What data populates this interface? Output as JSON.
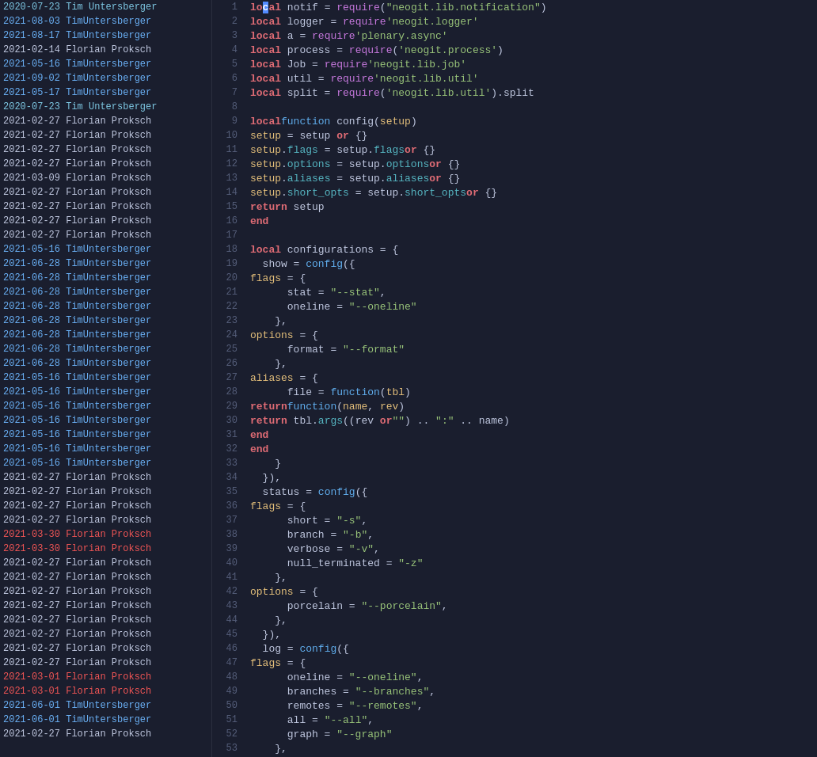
{
  "blame": [
    {
      "date": "2020-07-23",
      "author": "Tim Untersberger",
      "type": "tun-old"
    },
    {
      "date": "2021-08-03",
      "author": "TimUntersberger",
      "type": "tun"
    },
    {
      "date": "2021-08-17",
      "author": "TimUntersberger",
      "type": "tun"
    },
    {
      "date": "2021-02-14",
      "author": "Florian Proksch",
      "type": "fp"
    },
    {
      "date": "2021-05-16",
      "author": "TimUntersberger",
      "type": "tun"
    },
    {
      "date": "2021-09-02",
      "author": "TimUntersberger",
      "type": "tun"
    },
    {
      "date": "2021-05-17",
      "author": "TimUntersberger",
      "type": "tun"
    },
    {
      "date": "2020-07-23",
      "author": "Tim Untersberger",
      "type": "tun-old"
    },
    {
      "date": "2021-02-27",
      "author": "Florian Proksch",
      "type": "fp"
    },
    {
      "date": "2021-02-27",
      "author": "Florian Proksch",
      "type": "fp"
    },
    {
      "date": "2021-02-27",
      "author": "Florian Proksch",
      "type": "fp"
    },
    {
      "date": "2021-02-27",
      "author": "Florian Proksch",
      "type": "fp"
    },
    {
      "date": "2021-03-09",
      "author": "Florian Proksch",
      "type": "fp"
    },
    {
      "date": "2021-02-27",
      "author": "Florian Proksch",
      "type": "fp"
    },
    {
      "date": "2021-02-27",
      "author": "Florian Proksch",
      "type": "fp"
    },
    {
      "date": "2021-02-27",
      "author": "Florian Proksch",
      "type": "fp"
    },
    {
      "date": "2021-02-27",
      "author": "Florian Proksch",
      "type": "fp"
    },
    {
      "date": "2021-05-16",
      "author": "TimUntersberger",
      "type": "tun"
    },
    {
      "date": "2021-06-28",
      "author": "TimUntersberger",
      "type": "tun"
    },
    {
      "date": "2021-06-28",
      "author": "TimUntersberger",
      "type": "tun"
    },
    {
      "date": "2021-06-28",
      "author": "TimUntersberger",
      "type": "tun"
    },
    {
      "date": "2021-06-28",
      "author": "TimUntersberger",
      "type": "tun"
    },
    {
      "date": "2021-06-28",
      "author": "TimUntersberger",
      "type": "tun"
    },
    {
      "date": "2021-06-28",
      "author": "TimUntersberger",
      "type": "tun"
    },
    {
      "date": "2021-06-28",
      "author": "TimUntersberger",
      "type": "tun"
    },
    {
      "date": "2021-06-28",
      "author": "TimUntersberger",
      "type": "tun"
    },
    {
      "date": "2021-05-16",
      "author": "TimUntersberger",
      "type": "tun"
    },
    {
      "date": "2021-05-16",
      "author": "TimUntersberger",
      "type": "tun"
    },
    {
      "date": "2021-05-16",
      "author": "TimUntersberger",
      "type": "tun"
    },
    {
      "date": "2021-05-16",
      "author": "TimUntersberger",
      "type": "tun"
    },
    {
      "date": "2021-05-16",
      "author": "TimUntersberger",
      "type": "tun"
    },
    {
      "date": "2021-05-16",
      "author": "TimUntersberger",
      "type": "tun"
    },
    {
      "date": "2021-05-16",
      "author": "TimUntersberger",
      "type": "tun"
    },
    {
      "date": "2021-02-27",
      "author": "Florian Proksch",
      "type": "fp"
    },
    {
      "date": "2021-02-27",
      "author": "Florian Proksch",
      "type": "fp"
    },
    {
      "date": "2021-02-27",
      "author": "Florian Proksch",
      "type": "fp"
    },
    {
      "date": "2021-02-27",
      "author": "Florian Proksch",
      "type": "fp"
    },
    {
      "date": "2021-03-30",
      "author": "Florian Proksch",
      "type": "fp-red"
    },
    {
      "date": "2021-03-30",
      "author": "Florian Proksch",
      "type": "fp-red"
    },
    {
      "date": "2021-02-27",
      "author": "Florian Proksch",
      "type": "fp"
    },
    {
      "date": "2021-02-27",
      "author": "Florian Proksch",
      "type": "fp"
    },
    {
      "date": "2021-02-27",
      "author": "Florian Proksch",
      "type": "fp"
    },
    {
      "date": "2021-02-27",
      "author": "Florian Proksch",
      "type": "fp"
    },
    {
      "date": "2021-02-27",
      "author": "Florian Proksch",
      "type": "fp"
    },
    {
      "date": "2021-02-27",
      "author": "Florian Proksch",
      "type": "fp"
    },
    {
      "date": "2021-02-27",
      "author": "Florian Proksch",
      "type": "fp"
    },
    {
      "date": "2021-02-27",
      "author": "Florian Proksch",
      "type": "fp"
    },
    {
      "date": "2021-03-01",
      "author": "Florian Proksch",
      "type": "fp-red"
    },
    {
      "date": "2021-03-01",
      "author": "Florian Proksch",
      "type": "fp-red"
    },
    {
      "date": "2021-06-01",
      "author": "TimUntersberger",
      "type": "tun"
    },
    {
      "date": "2021-06-01",
      "author": "TimUntersberger",
      "type": "tun"
    },
    {
      "date": "2021-02-27",
      "author": "Florian Proksch",
      "type": "fp"
    }
  ],
  "lines": [
    {
      "num": 1,
      "html": "<span class='kw'>local</span> notif = <span class='kw2'>require</span>(<span class='str'>\"neogit.lib.notification\"</span>)"
    },
    {
      "num": 2,
      "html": "<span class='kw'>local</span> logger = <span class='kw2'>require</span> <span class='str'>'neogit.logger'</span>"
    },
    {
      "num": 3,
      "html": "<span class='kw'>local</span> a = <span class='kw2'>require</span> <span class='str'>'plenary.async'</span>"
    },
    {
      "num": 4,
      "html": "<span class='kw'>local</span> process = <span class='kw2'>require</span>(<span class='str'>'neogit.process'</span>)"
    },
    {
      "num": 5,
      "html": "<span class='kw'>local</span> Job = <span class='kw2'>require</span> <span class='str'>'neogit.lib.job'</span>"
    },
    {
      "num": 6,
      "html": "<span class='kw'>local</span> util = <span class='kw2'>require</span> <span class='str'>'neogit.lib.util'</span>"
    },
    {
      "num": 7,
      "html": "<span class='kw'>local</span> split = <span class='kw2'>require</span>(<span class='str'>'neogit.lib.util'</span>).split"
    },
    {
      "num": 8,
      "html": ""
    },
    {
      "num": 9,
      "html": "<span class='kw'>local</span> <span class='fn'>function</span> config(<span class='varname'>setup</span>)"
    },
    {
      "num": 10,
      "html": "  <span class='varname'>setup</span> = setup <span class='kw'>or</span> {}"
    },
    {
      "num": 11,
      "html": "  <span class='varname'>setup</span>.<span class='str2'>flags</span> = setup.<span class='str2'>flags</span> <span class='kw'>or</span> {}"
    },
    {
      "num": 12,
      "html": "  <span class='varname'>setup</span>.<span class='str2'>options</span> = setup.<span class='str2'>options</span> <span class='kw'>or</span> {}"
    },
    {
      "num": 13,
      "html": "  <span class='varname'>setup</span>.<span class='str2'>aliases</span> = setup.<span class='str2'>aliases</span> <span class='kw'>or</span> {}"
    },
    {
      "num": 14,
      "html": "  <span class='varname'>setup</span>.<span class='str2'>short_opts</span> = setup.<span class='str2'>short_opts</span> <span class='kw'>or</span> {}"
    },
    {
      "num": 15,
      "html": "  <span class='kw'>return</span> setup"
    },
    {
      "num": 16,
      "html": "<span class='kw'>end</span>"
    },
    {
      "num": 17,
      "html": ""
    },
    {
      "num": 18,
      "html": "<span class='kw'>local</span> configurations = {"
    },
    {
      "num": 19,
      "html": "  show = <span class='fn'>config</span>({"
    },
    {
      "num": 20,
      "html": "    <span class='varname'>flags</span> = {"
    },
    {
      "num": 21,
      "html": "      stat = <span class='str'>\"--stat\"</span>,"
    },
    {
      "num": 22,
      "html": "      oneline = <span class='str'>\"--oneline\"</span>"
    },
    {
      "num": 23,
      "html": "    },"
    },
    {
      "num": 24,
      "html": "    <span class='varname'>options</span> = {"
    },
    {
      "num": 25,
      "html": "      format = <span class='str'>\"--format\"</span>"
    },
    {
      "num": 26,
      "html": "    },"
    },
    {
      "num": 27,
      "html": "    <span class='varname'>aliases</span> = {"
    },
    {
      "num": 28,
      "html": "      file = <span class='fn'>function</span>(<span class='varname'>tbl</span>)"
    },
    {
      "num": 29,
      "html": "        <span class='kw'>return</span> <span class='fn'>function</span>(<span class='varname'>name</span>, <span class='varname'>rev</span>)"
    },
    {
      "num": 30,
      "html": "          <span class='kw'>return</span> tbl.<span class='str2'>args</span>((rev <span class='kw'>or</span> <span class='str'>\"\"</span>) .. <span class='str'>\":\"</span> .. name)"
    },
    {
      "num": 31,
      "html": "        <span class='kw'>end</span>"
    },
    {
      "num": 32,
      "html": "      <span class='kw'>end</span>"
    },
    {
      "num": 33,
      "html": "    }"
    },
    {
      "num": 34,
      "html": "  }),"
    },
    {
      "num": 35,
      "html": "  status = <span class='fn'>config</span>({"
    },
    {
      "num": 36,
      "html": "    <span class='varname'>flags</span> = {"
    },
    {
      "num": 37,
      "html": "      short = <span class='str'>\"-s\"</span>,"
    },
    {
      "num": 38,
      "html": "      branch = <span class='str'>\"-b\"</span>,"
    },
    {
      "num": 39,
      "html": "      verbose = <span class='str'>\"-v\"</span>,"
    },
    {
      "num": 40,
      "html": "      null_terminated = <span class='str'>\"-z\"</span>"
    },
    {
      "num": 41,
      "html": "    },"
    },
    {
      "num": 42,
      "html": "    <span class='varname'>options</span> = {"
    },
    {
      "num": 43,
      "html": "      porcelain = <span class='str'>\"--porcelain\"</span>,"
    },
    {
      "num": 44,
      "html": "    },"
    },
    {
      "num": 45,
      "html": "  }),"
    },
    {
      "num": 46,
      "html": "  log = <span class='fn'>config</span>({"
    },
    {
      "num": 47,
      "html": "    <span class='varname'>flags</span> = {"
    },
    {
      "num": 48,
      "html": "      oneline = <span class='str'>\"--oneline\"</span>,"
    },
    {
      "num": 49,
      "html": "      branches = <span class='str'>\"--branches\"</span>,"
    },
    {
      "num": 50,
      "html": "      remotes = <span class='str'>\"--remotes\"</span>,"
    },
    {
      "num": 51,
      "html": "      all = <span class='str'>\"--all\"</span>,"
    },
    {
      "num": 52,
      "html": "      graph = <span class='str'>\"--graph\"</span>"
    },
    {
      "num": 53,
      "html": "    },"
    }
  ]
}
